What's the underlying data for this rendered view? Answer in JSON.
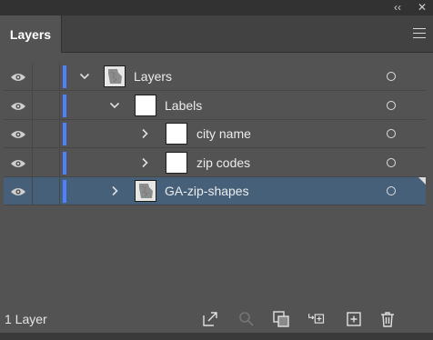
{
  "window": {
    "collapse_glyph": "‹‹",
    "close_glyph": "✕"
  },
  "panel": {
    "tab_label": "Layers",
    "menu_icon": "hamburger-menu-icon"
  },
  "layers": [
    {
      "name": "Layers",
      "indent": 0,
      "expanded": true,
      "thumb": "map",
      "selected": false
    },
    {
      "name": "Labels",
      "indent": 1,
      "expanded": true,
      "thumb": "blank",
      "selected": false
    },
    {
      "name": "city name",
      "indent": 2,
      "expanded": false,
      "thumb": "blank",
      "selected": false
    },
    {
      "name": "zip codes",
      "indent": 2,
      "expanded": false,
      "thumb": "blank",
      "selected": false
    },
    {
      "name": "GA-zip-shapes",
      "indent": 1,
      "expanded": false,
      "thumb": "map",
      "selected": true
    }
  ],
  "footer": {
    "layer_count": "1 Layer",
    "actions": [
      "export-icon",
      "search-icon",
      "clipping-mask-icon",
      "new-sublayer-icon",
      "new-layer-icon",
      "delete-icon"
    ]
  },
  "colors": {
    "layer_color": "#4f80ff",
    "selected_row": "#46607a",
    "panel_bg": "#535353"
  }
}
